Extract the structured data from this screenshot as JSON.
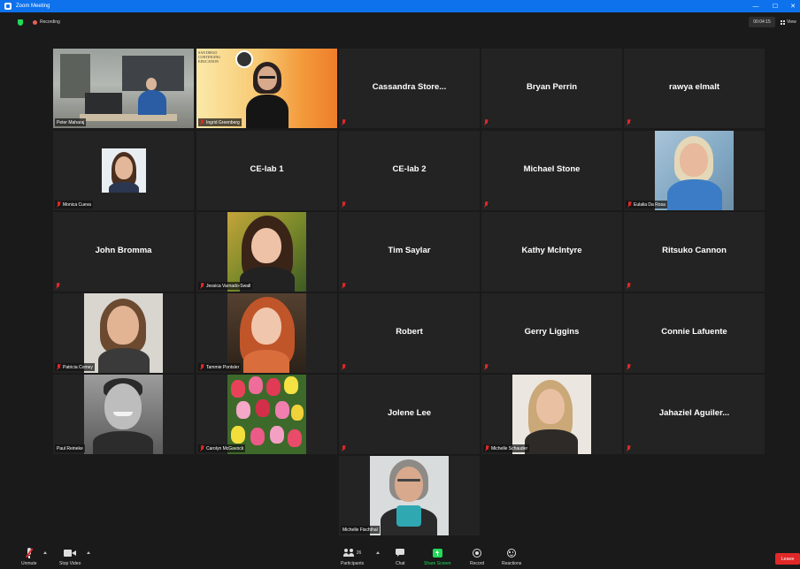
{
  "window": {
    "title": "Zoom Meeting",
    "minimize": "—",
    "maximize": "☐",
    "close": "✕"
  },
  "status": {
    "recording_label": "Recording",
    "timer": "00:04:15",
    "view_label": "View"
  },
  "participants": [
    {
      "name": "Peter Maharaj",
      "type": "video"
    },
    {
      "name": "Ingrid Greenberg",
      "type": "video"
    },
    {
      "name": "Cassandra Store...",
      "type": "name"
    },
    {
      "name": "Bryan Perrin",
      "type": "name"
    },
    {
      "name": "rawya elmalt",
      "type": "name"
    },
    {
      "name": "Monica Cueva",
      "type": "photo"
    },
    {
      "name": "CE-lab 1",
      "type": "name"
    },
    {
      "name": "CE-lab 2",
      "type": "name"
    },
    {
      "name": "Michael Stone",
      "type": "name"
    },
    {
      "name": "Eulalia Da Rosa",
      "type": "photo"
    },
    {
      "name": "John Bromma",
      "type": "name"
    },
    {
      "name": "Jessica Varnado-Swall",
      "type": "photo"
    },
    {
      "name": "Tim Saylar",
      "type": "name"
    },
    {
      "name": "Kathy McIntyre",
      "type": "name"
    },
    {
      "name": "Ritsuko Cannon",
      "type": "name"
    },
    {
      "name": "Patricia Comey",
      "type": "photo"
    },
    {
      "name": "Tammie Pontsler",
      "type": "photo"
    },
    {
      "name": "Robert",
      "type": "name"
    },
    {
      "name": "Gerry Liggins",
      "type": "name"
    },
    {
      "name": "Connie Lafuente",
      "type": "name"
    },
    {
      "name": "Paul Reineke",
      "type": "photo"
    },
    {
      "name": "Carolyn McGavock",
      "type": "photo"
    },
    {
      "name": "Jolene Lee",
      "type": "name"
    },
    {
      "name": "Michelle Schauder",
      "type": "photo"
    },
    {
      "name": "Jahaziel  Aguiler...",
      "type": "name"
    },
    {
      "name": "Michelle Fischthal",
      "type": "photo"
    }
  ],
  "branding": {
    "line1": "SAN DIEGO",
    "line2": "CONTINUING",
    "line3": "EDUCATION"
  },
  "toolbar": {
    "unmute": "Unmute",
    "stop_video": "Stop Video",
    "participants": "Participants",
    "participant_count": "26",
    "chat": "Chat",
    "share_screen": "Share Screen",
    "record": "Record",
    "reactions": "Reactions",
    "leave": "Leave"
  },
  "colors": {
    "titlebar": "#0e72ed",
    "active_speaker": "#c8f046",
    "share_green": "#23d959",
    "muted_red": "#e02828",
    "leave_red": "#e02828"
  }
}
